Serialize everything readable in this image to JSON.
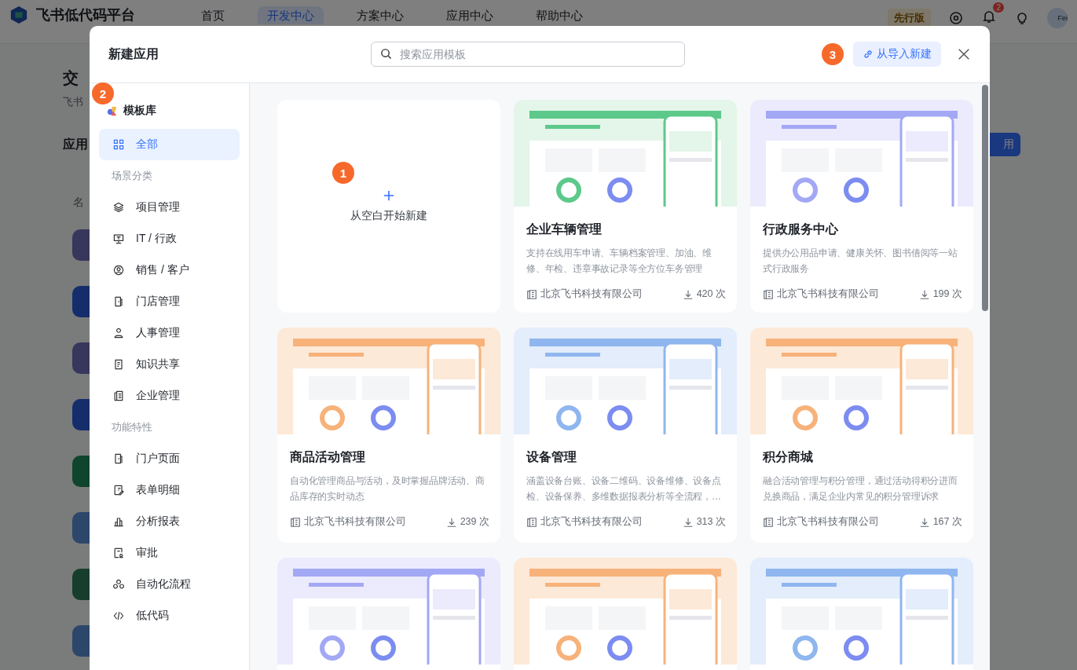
{
  "background_app": {
    "logo": "飞书低代码平台",
    "nav": [
      {
        "label": "首页",
        "selected": false
      },
      {
        "label": "开发中心",
        "selected": true
      },
      {
        "label": "方案中心",
        "selected": false
      },
      {
        "label": "应用中心",
        "selected": false
      },
      {
        "label": "帮助中心",
        "selected": false
      }
    ],
    "edition_badge": "先行版",
    "notification_count": "2",
    "avatar": "Fei",
    "page_title": "交",
    "page_subtitle": "飞书",
    "section_label": "应用",
    "column_header": "名",
    "action_button": "用"
  },
  "dialog": {
    "title": "新建应用",
    "search": {
      "placeholder": "搜索应用模板"
    },
    "import_marker": "3",
    "import_button": "从导入新建"
  },
  "sidebar": {
    "marker": "2",
    "title": "模板库",
    "items": [
      {
        "kind": "item",
        "label": "全部",
        "selected": true
      },
      {
        "kind": "heading",
        "label": "场景分类"
      },
      {
        "kind": "item",
        "label": "项目管理",
        "selected": false
      },
      {
        "kind": "item",
        "label": "IT / 行政",
        "selected": false
      },
      {
        "kind": "item",
        "label": "销售 / 客户",
        "selected": false
      },
      {
        "kind": "item",
        "label": "门店管理",
        "selected": false
      },
      {
        "kind": "item",
        "label": "人事管理",
        "selected": false
      },
      {
        "kind": "item",
        "label": "知识共享",
        "selected": false
      },
      {
        "kind": "item",
        "label": "企业管理",
        "selected": false
      },
      {
        "kind": "heading",
        "label": "功能特性"
      },
      {
        "kind": "item",
        "label": "门户页面",
        "selected": false
      },
      {
        "kind": "item",
        "label": "表单明细",
        "selected": false
      },
      {
        "kind": "item",
        "label": "分析报表",
        "selected": false
      },
      {
        "kind": "item",
        "label": "审批",
        "selected": false
      },
      {
        "kind": "item",
        "label": "自动化流程",
        "selected": false
      },
      {
        "kind": "item",
        "label": "低代码",
        "selected": false
      }
    ]
  },
  "blank_card": {
    "marker": "1",
    "label": "从空白开始新建"
  },
  "templates": [
    {
      "thumbnail": {
        "kind": "picture"
      },
      "title": "企业车辆管理",
      "description": "支持在线用车申请、车辆档案管理、加油、维修、年检、违章事故记录等全方位车务管理",
      "publisher": "北京飞书科技有限公司",
      "downloads": "420 次"
    },
    {
      "thumbnail": {
        "kind": "picture"
      },
      "title": "行政服务中心",
      "description": "提供办公用品申请、健康关怀、图书借阅等一站式行政服务",
      "publisher": "北京飞书科技有限公司",
      "downloads": "199 次"
    },
    {
      "thumbnail": {
        "kind": "picture"
      },
      "title": "商品活动管理",
      "description": "自动化管理商品与活动，及时掌握品牌活动、商品库存的实时动态",
      "publisher": "北京飞书科技有限公司",
      "downloads": "239 次"
    },
    {
      "thumbnail": {
        "kind": "picture"
      },
      "title": "设备管理",
      "description": "涵盖设备台账、设备二维码、设备维修、设备点检、设备保养、多维数据报表分析等全流程，…",
      "publisher": "北京飞书科技有限公司",
      "downloads": "313 次"
    },
    {
      "thumbnail": {
        "kind": "picture"
      },
      "title": "积分商城",
      "description": "融合活动管理与积分管理，通过活动得积分进而兑换商品，满足企业内常见的积分管理诉求",
      "publisher": "北京飞书科技有限公司",
      "downloads": "167 次"
    },
    {
      "thumbnail": {
        "kind": "picture"
      }
    },
    {
      "thumbnail": {
        "kind": "picture"
      }
    },
    {
      "thumbnail": {
        "kind": "picture"
      }
    }
  ]
}
